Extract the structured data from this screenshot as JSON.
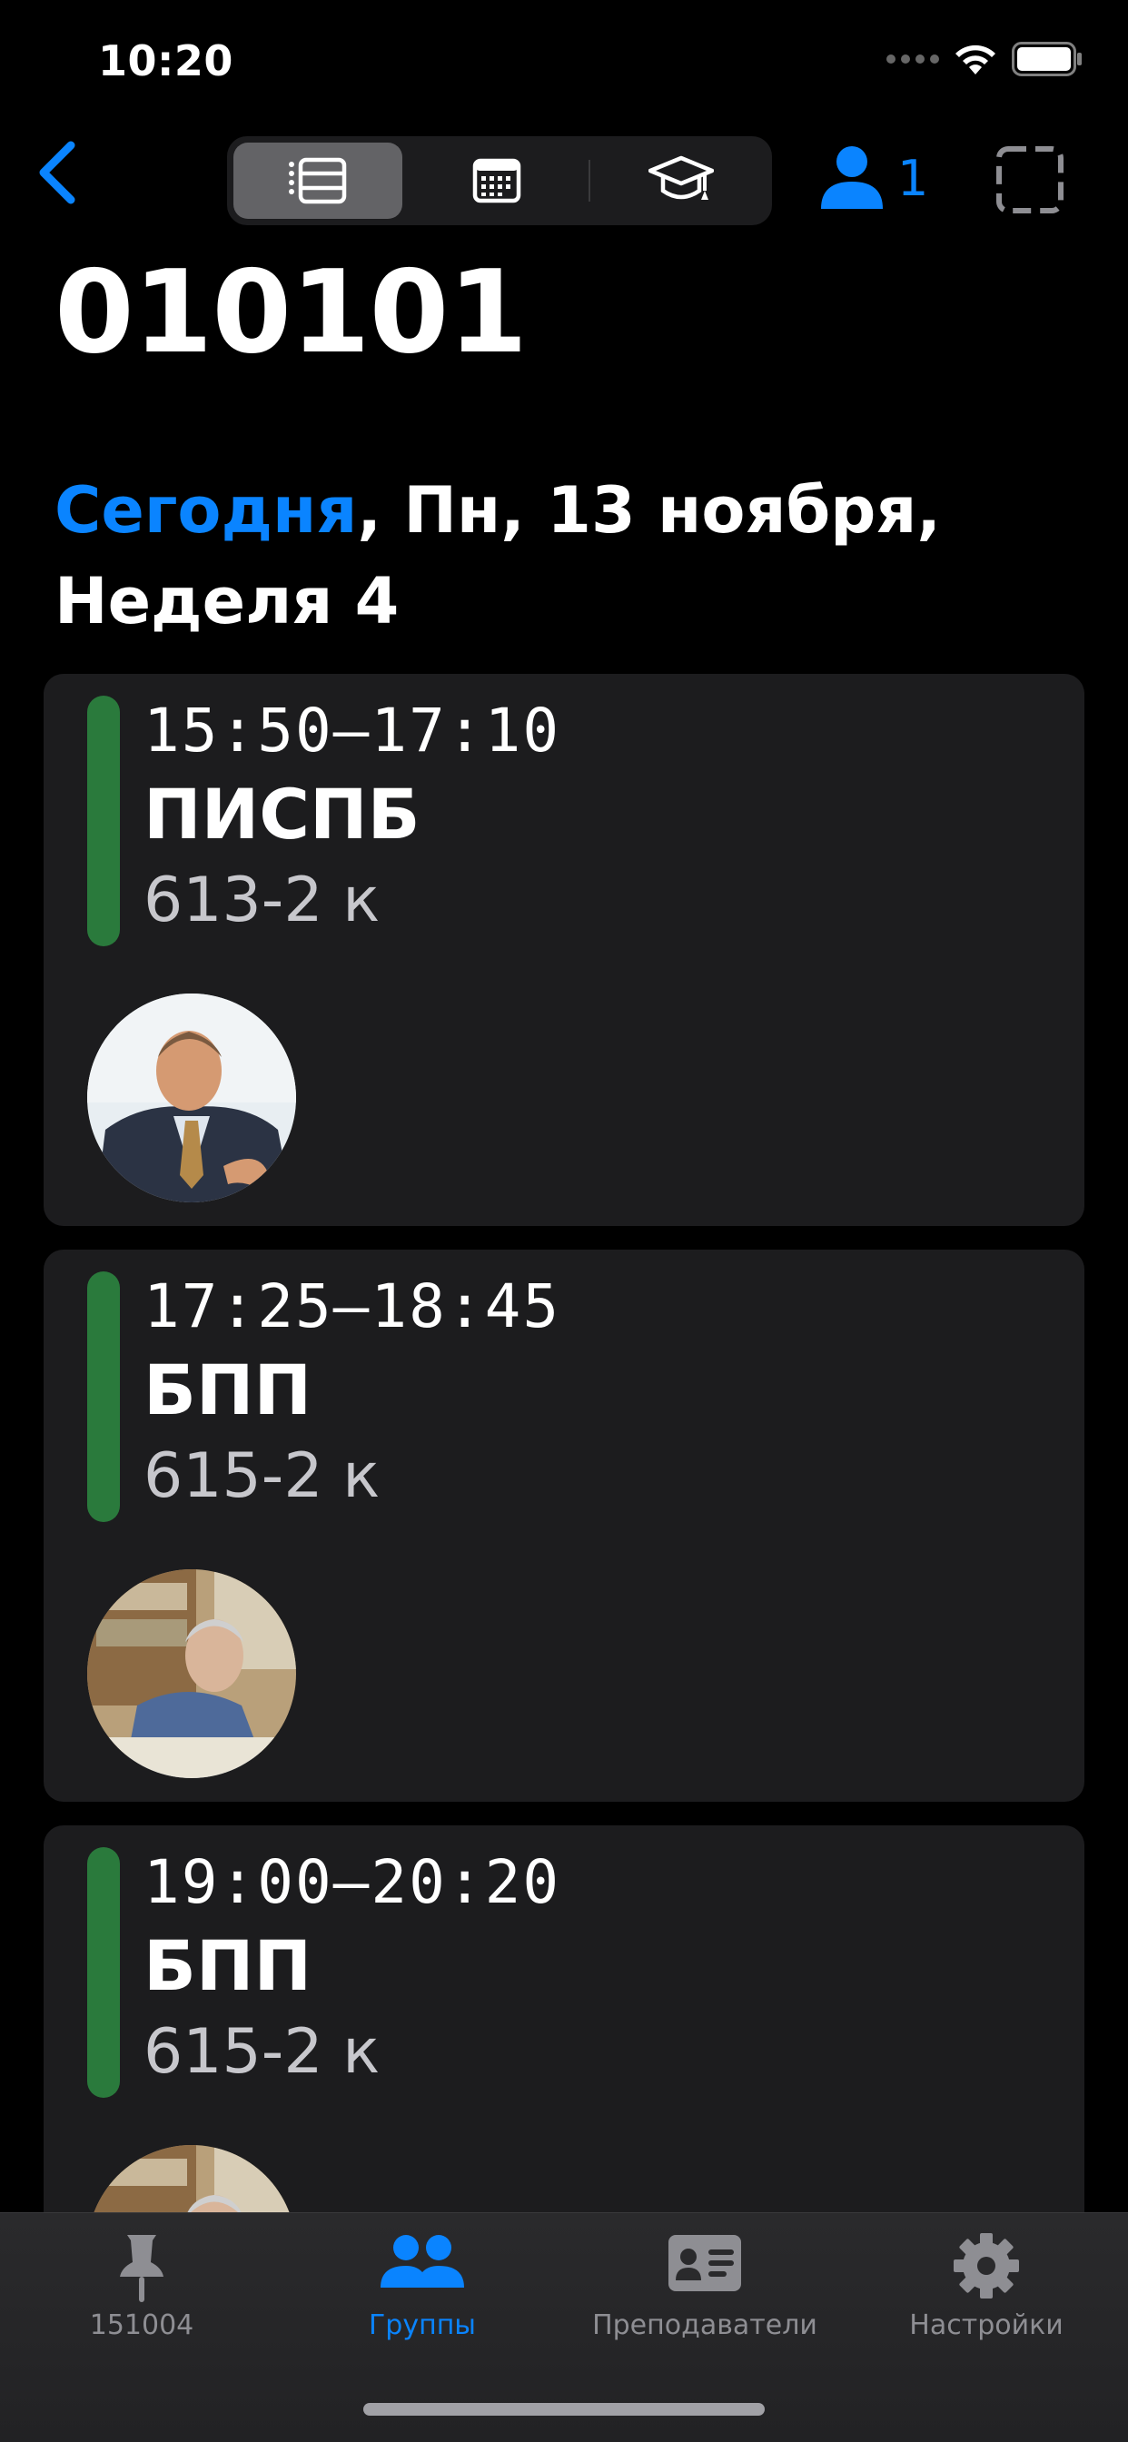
{
  "status": {
    "time": "10:20"
  },
  "header": {
    "group_number": "010101",
    "persons_count": "1"
  },
  "date_heading": {
    "today": "Сегодня",
    "rest": ", Пн, 13 ноября,",
    "week": "Неделя 4"
  },
  "colors": {
    "accent": "#0a84ff",
    "lesson_bar": "#2a7a3c",
    "card_bg": "#1c1c1e"
  },
  "lessons": [
    {
      "time": "15:50–17:10",
      "subject": "ПИСПБ",
      "room": "613-2 к"
    },
    {
      "time": "17:25–18:45",
      "subject": "БПП",
      "room": "615-2 к"
    },
    {
      "time": "19:00–20:20",
      "subject": "БПП",
      "room": "615-2 к"
    }
  ],
  "tabbar": {
    "tabs": [
      {
        "label": "151004",
        "icon": "pin-icon"
      },
      {
        "label": "Группы",
        "icon": "people-icon",
        "active": true
      },
      {
        "label": "Преподаватели",
        "icon": "contact-card-icon"
      },
      {
        "label": "Настройки",
        "icon": "gear-icon"
      }
    ]
  }
}
